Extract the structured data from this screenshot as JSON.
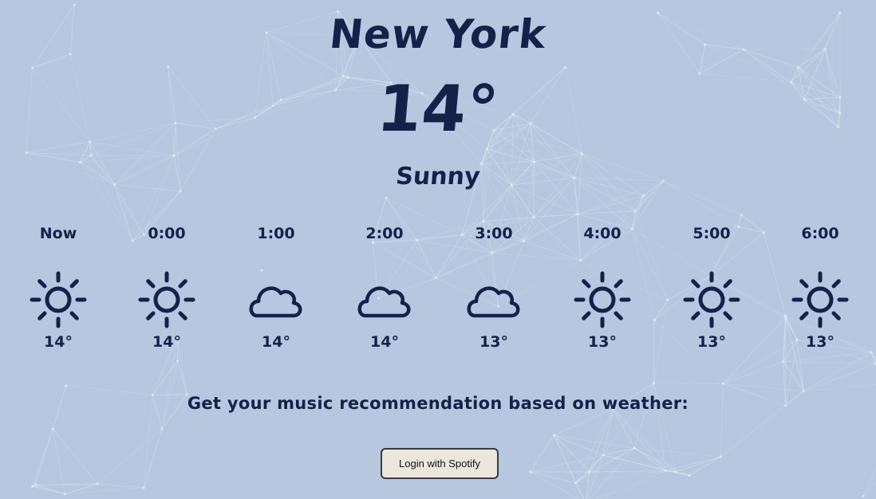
{
  "city": "New York",
  "current": {
    "temp": "14°",
    "condition": "Sunny"
  },
  "hourly": [
    {
      "label": "Now",
      "icon": "sun-icon",
      "temp": "14°"
    },
    {
      "label": "0:00",
      "icon": "sun-icon",
      "temp": "14°"
    },
    {
      "label": "1:00",
      "icon": "cloud-icon",
      "temp": "14°"
    },
    {
      "label": "2:00",
      "icon": "cloud-icon",
      "temp": "14°"
    },
    {
      "label": "3:00",
      "icon": "cloud-icon",
      "temp": "13°"
    },
    {
      "label": "4:00",
      "icon": "sun-icon",
      "temp": "13°"
    },
    {
      "label": "5:00",
      "icon": "sun-icon",
      "temp": "13°"
    },
    {
      "label": "6:00",
      "icon": "sun-icon",
      "temp": "13°"
    }
  ],
  "recommendation_prompt": "Get your music recommendation based on weather:",
  "login_button_label": "Login with Spotify",
  "colors": {
    "background": "#b7c7df",
    "text": "#14224a",
    "network_lines": "#e6edf7",
    "button_bg": "#ece7dc"
  }
}
